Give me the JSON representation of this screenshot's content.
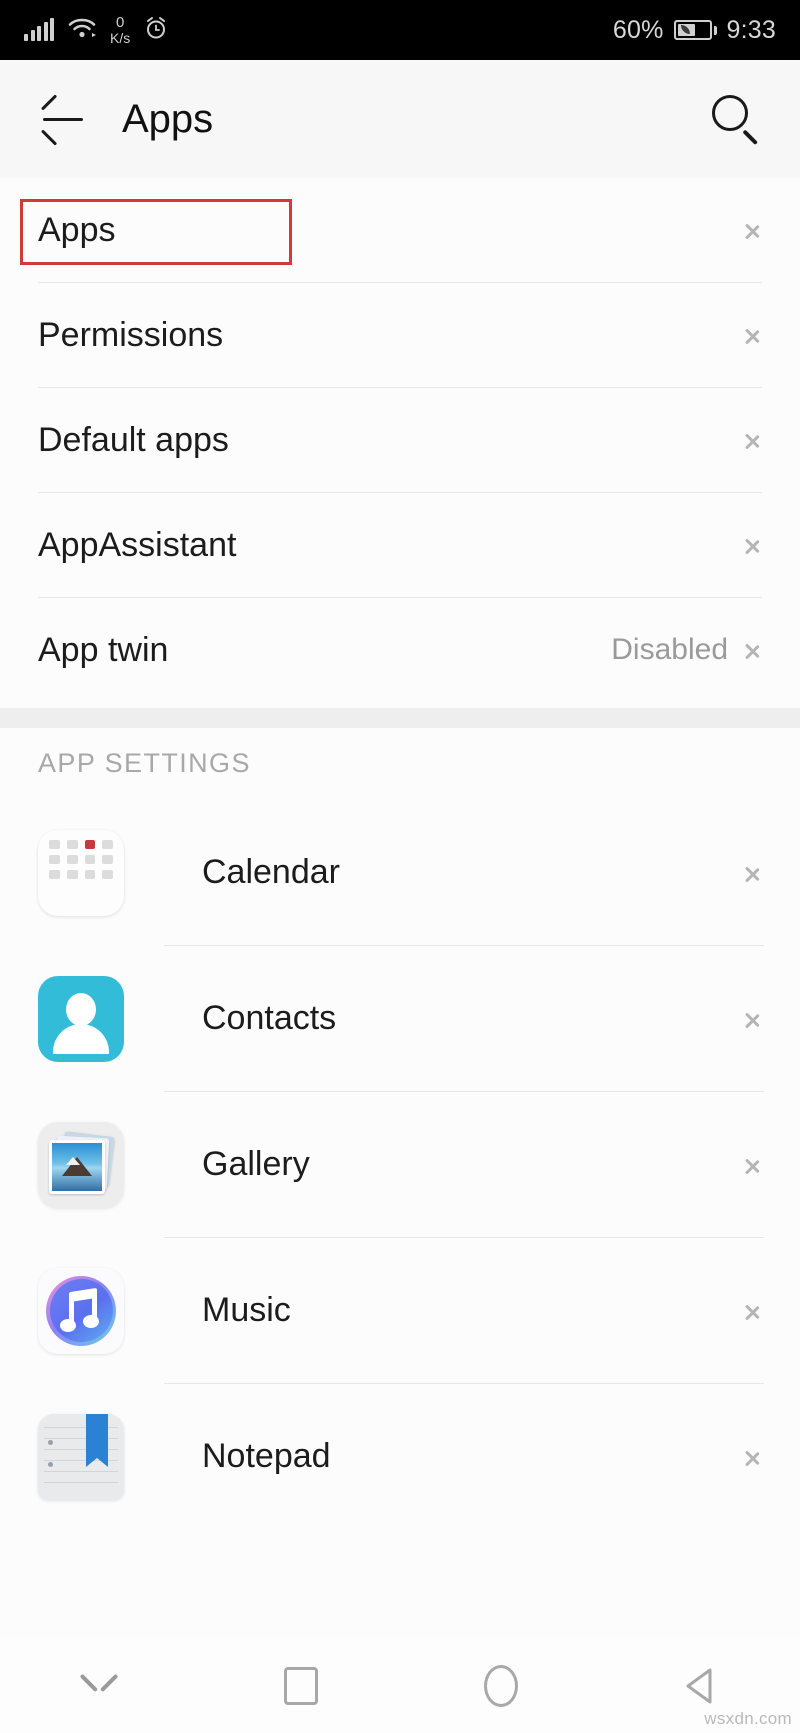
{
  "status_bar": {
    "signal_icon": "signal-bars-icon",
    "wifi_icon": "wifi-icon",
    "network_speed_value": "0",
    "network_speed_unit": "K/s",
    "alarm_icon": "alarm-clock-icon",
    "battery_percent": "60%",
    "battery_icon": "battery-eco-icon",
    "time": "9:33"
  },
  "app_bar": {
    "back_icon": "back-arrow-icon",
    "title": "Apps",
    "search_icon": "search-icon"
  },
  "settings_list": {
    "items": [
      {
        "label": "Apps",
        "value": "",
        "highlighted": true
      },
      {
        "label": "Permissions",
        "value": "",
        "highlighted": false
      },
      {
        "label": "Default apps",
        "value": "",
        "highlighted": false
      },
      {
        "label": "AppAssistant",
        "value": "",
        "highlighted": false
      },
      {
        "label": "App twin",
        "value": "Disabled",
        "highlighted": false
      }
    ]
  },
  "app_settings": {
    "header": "APP SETTINGS",
    "items": [
      {
        "label": "Calendar",
        "icon": "calendar-app-icon"
      },
      {
        "label": "Contacts",
        "icon": "contacts-app-icon"
      },
      {
        "label": "Gallery",
        "icon": "gallery-app-icon"
      },
      {
        "label": "Music",
        "icon": "music-app-icon"
      },
      {
        "label": "Notepad",
        "icon": "notepad-app-icon"
      }
    ]
  },
  "nav_bar": {
    "collapse_icon": "chevron-down-icon",
    "recents_icon": "recents-square-icon",
    "home_icon": "home-circle-icon",
    "back_icon": "back-triangle-icon"
  },
  "watermark": "wsxdn.com",
  "colors": {
    "annotation_red": "#d13a3a",
    "calendar_red": "#c8393f",
    "contacts_cyan": "#33bcd8",
    "notepad_blue": "#2b82d4",
    "chevron_gray": "#b5b5b5"
  }
}
